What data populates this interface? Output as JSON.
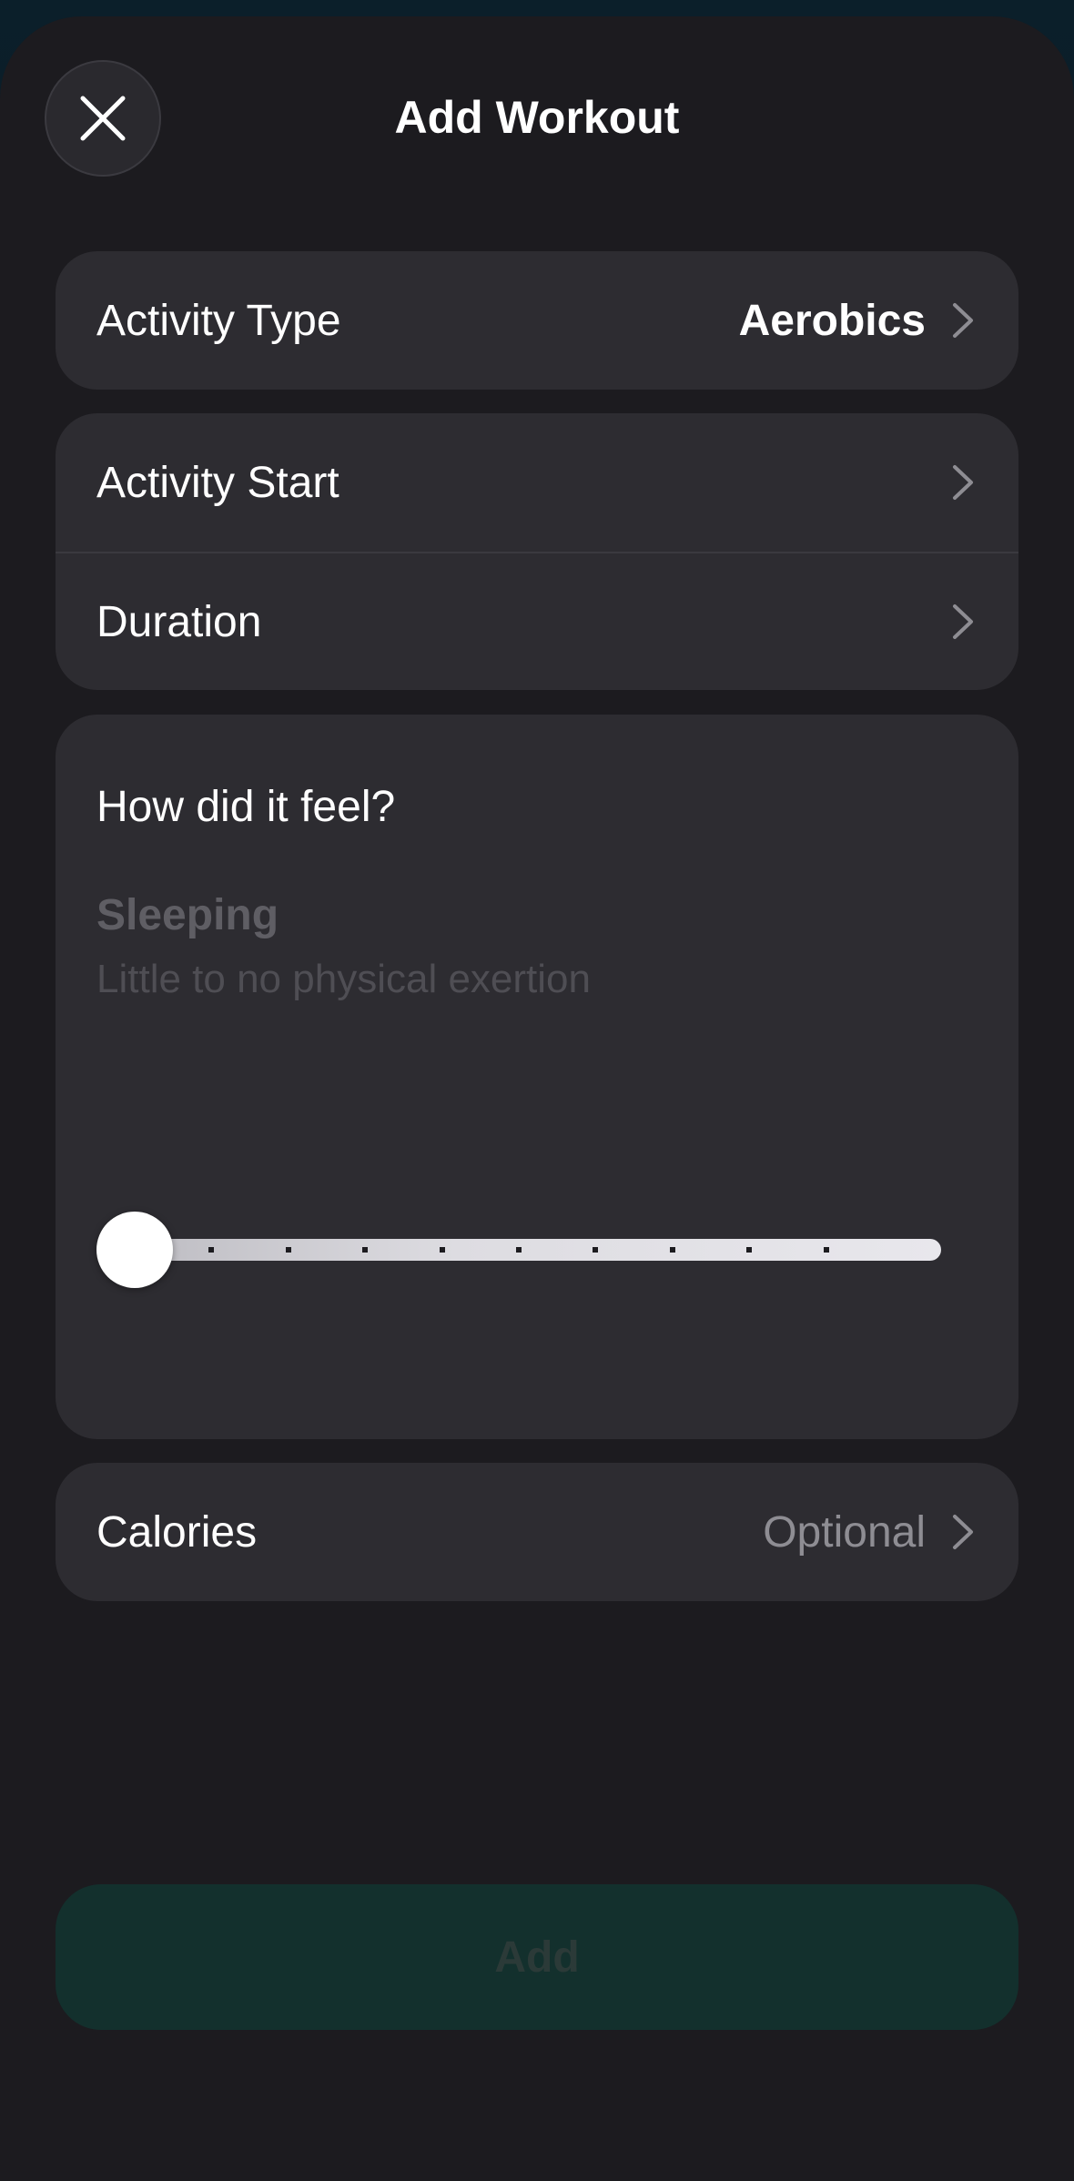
{
  "header": {
    "title": "Add Workout",
    "close_icon": "close-icon"
  },
  "activity_type": {
    "label": "Activity Type",
    "value": "Aerobics"
  },
  "timing": {
    "start_label": "Activity Start",
    "duration_label": "Duration"
  },
  "feel": {
    "question": "How did it feel?",
    "level_title": "Sleeping",
    "level_description": "Little to no physical exertion",
    "slider_level": 0,
    "slider_max": 10
  },
  "calories": {
    "label": "Calories",
    "placeholder": "Optional"
  },
  "footer": {
    "add_label": "Add"
  },
  "colors": {
    "accent_disabled": "#13302d",
    "card_background": "#2d2c31",
    "sheet_background": "#1c1b1f"
  }
}
